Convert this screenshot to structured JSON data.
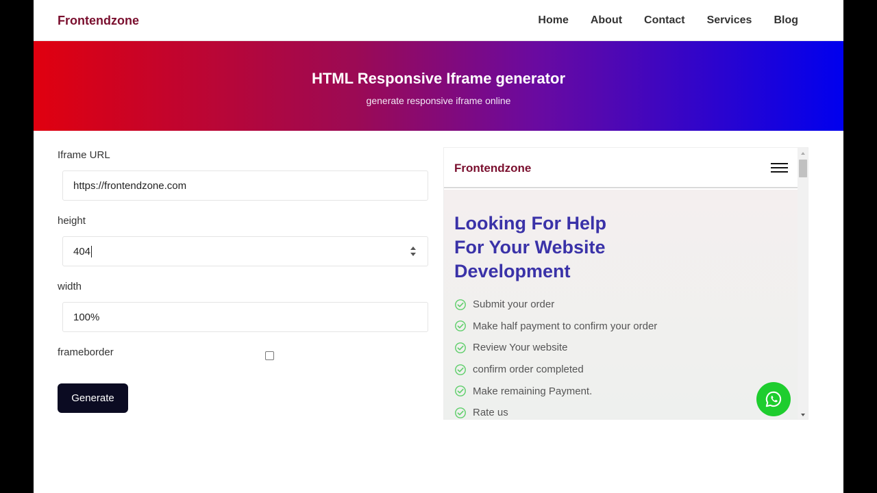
{
  "site": {
    "brand": "Frontendzone",
    "nav": [
      "Home",
      "About",
      "Contact",
      "Services",
      "Blog"
    ]
  },
  "hero": {
    "title": "HTML Responsive Iframe generator",
    "subtitle": "generate responsive iframe online"
  },
  "form": {
    "url_label": "Iframe URL",
    "url_value": "https://frontendzone.com",
    "height_label": "height",
    "height_value": "404",
    "width_label": "width",
    "width_value": "100%",
    "frameborder_label": "frameborder",
    "frameborder_checked": false,
    "generate_label": "Generate"
  },
  "preview": {
    "brand": "Frontendzone",
    "heading": "Looking For Help For Your Website Development",
    "steps": [
      "Submit your order",
      "Make half payment to confirm your order",
      "Review Your website",
      "confirm order completed",
      "Make remaining Payment.",
      "Rate us"
    ]
  },
  "colors": {
    "brand": "#7a0f2e",
    "hero_start": "#e0000f",
    "hero_end": "#0000ee",
    "heading": "#3a32a8",
    "check": "#5fcf6b",
    "whatsapp": "#1ecd2e",
    "button": "#0b0b22"
  },
  "icons": [
    "hamburger-menu-icon",
    "check-circle-icon",
    "whatsapp-icon"
  ]
}
